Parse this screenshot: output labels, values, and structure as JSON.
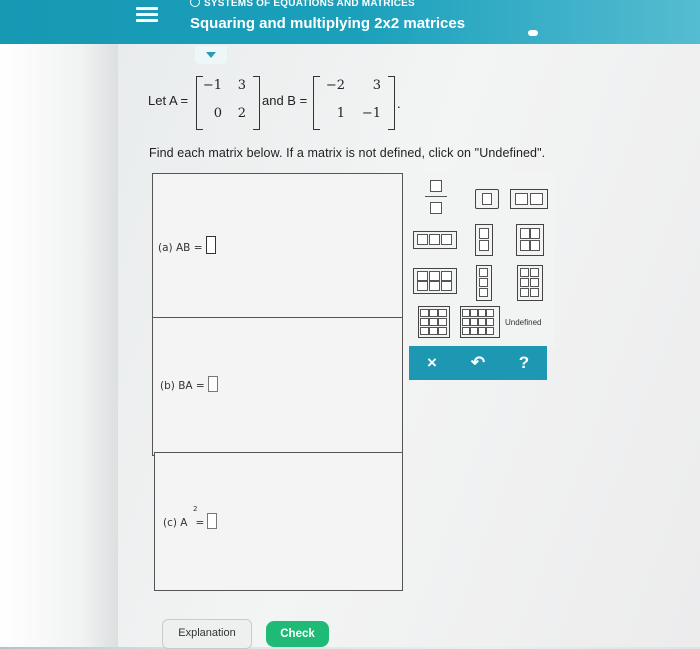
{
  "header": {
    "topic": "SYSTEMS OF EQUATIONS AND MATRICES",
    "title": "Squaring and multiplying 2x2 matrices"
  },
  "problem": {
    "let_label": "Let A =",
    "matrix_A": [
      [
        "−1",
        "3"
      ],
      [
        "0",
        "2"
      ]
    ],
    "and_label": "and B =",
    "matrix_B": [
      [
        "−2",
        "3"
      ],
      [
        "1",
        "−1"
      ]
    ],
    "period": ".",
    "instruction": "Find each matrix below. If a matrix is not defined, click on \"Undefined\"."
  },
  "parts": [
    {
      "label": "(a) AB ="
    },
    {
      "label": "(b) BA ="
    },
    {
      "label": "(c) A",
      "superscript": "2",
      "suffix": "="
    }
  ],
  "palette": {
    "undefined_label": "Undefined",
    "icons": [
      "fraction-icon",
      "matrix-1x1-icon",
      "matrix-1x2-icon",
      "matrix-1x3-icon",
      "matrix-2x1-icon",
      "matrix-2x2-icon",
      "matrix-2x3-icon",
      "matrix-3x1-icon",
      "matrix-3x2-icon",
      "matrix-3x3-icon",
      "matrix-3x4-icon"
    ]
  },
  "actions": {
    "clear": "×",
    "undo": "↶",
    "help": "?"
  },
  "footer": {
    "explanation": "Explanation",
    "check": "Check"
  },
  "colors": {
    "header": "#1a9ab5",
    "check": "#1fbb76",
    "toolbar": "#1d97b2"
  }
}
